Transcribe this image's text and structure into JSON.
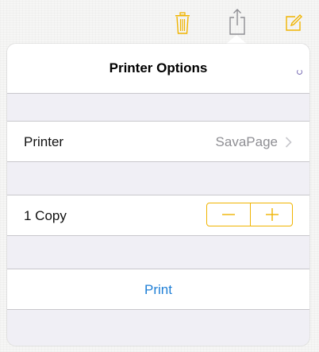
{
  "toolbar": {
    "icons": [
      "trash-icon",
      "share-icon",
      "compose-icon"
    ],
    "accent_color": "#f0b400"
  },
  "popover": {
    "title": "Printer Options",
    "printer": {
      "label": "Printer",
      "value": "SavaPage"
    },
    "copies": {
      "label": "1 Copy",
      "count": 1,
      "decrement_icon": "minus-icon",
      "increment_icon": "plus-icon"
    },
    "print_button": "Print",
    "link_color": "#1f7fd6"
  }
}
